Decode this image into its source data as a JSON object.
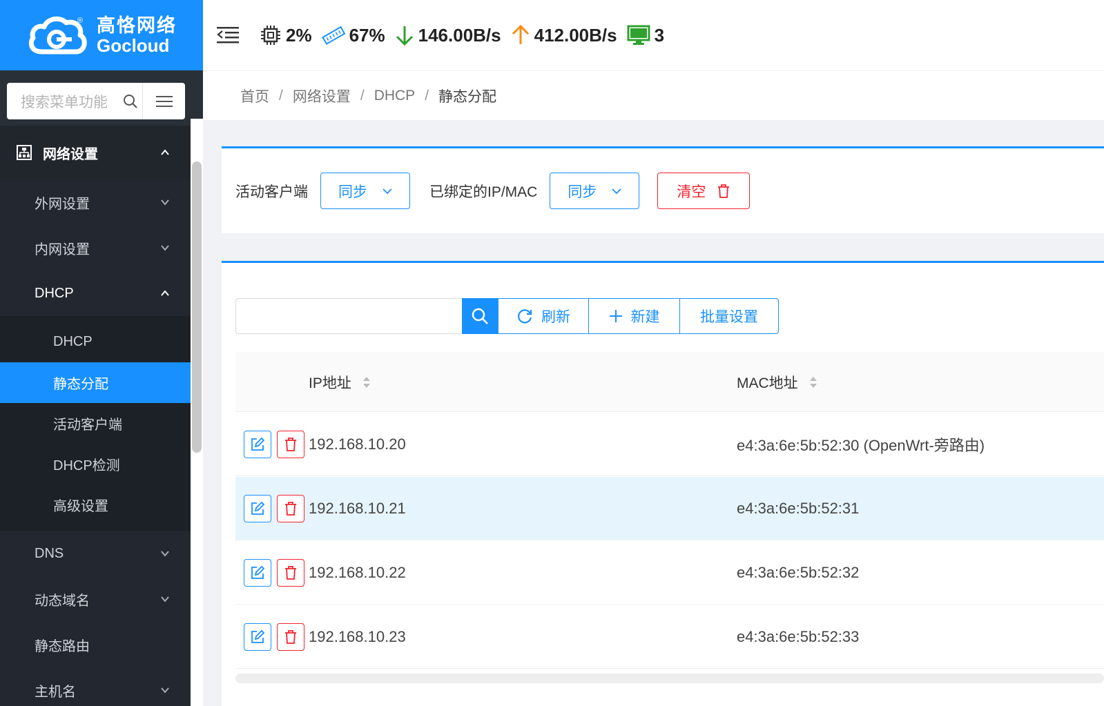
{
  "brand": {
    "name_cn": "高恪网络",
    "name_en": "Gocloud",
    "reg": "®"
  },
  "sidebar": {
    "search_placeholder": "搜索菜单功能",
    "group": {
      "label": "网络设置"
    },
    "items": [
      {
        "label": "外网设置"
      },
      {
        "label": "内网设置"
      },
      {
        "label": "DHCP"
      }
    ],
    "dhcp_children": [
      {
        "label": "DHCP"
      },
      {
        "label": "静态分配"
      },
      {
        "label": "活动客户端"
      },
      {
        "label": "DHCP检测"
      },
      {
        "label": "高级设置"
      }
    ],
    "items_after": [
      {
        "label": "DNS"
      },
      {
        "label": "动态域名"
      },
      {
        "label": "静态路由"
      },
      {
        "label": "主机名"
      }
    ]
  },
  "topbar": {
    "cpu": "2%",
    "mem": "67%",
    "down": "146.00B/s",
    "up": "412.00B/s",
    "clients": "3"
  },
  "breadcrumb": [
    "首页",
    "网络设置",
    "DHCP",
    "静态分配"
  ],
  "sync_card": {
    "active_label": "活动客户端",
    "active_btn": "同步",
    "bound_label": "已绑定的IP/MAC",
    "bound_btn": "同步",
    "clear_btn": "清空"
  },
  "toolbar": {
    "refresh": "刷新",
    "new": "新建",
    "batch": "批量设置"
  },
  "table": {
    "headers": {
      "ip": "IP地址",
      "mac": "MAC地址"
    },
    "rows": [
      {
        "ip": "192.168.10.20",
        "mac": "e4:3a:6e:5b:52:30 (OpenWrt-旁路由)"
      },
      {
        "ip": "192.168.10.21",
        "mac": "e4:3a:6e:5b:52:31"
      },
      {
        "ip": "192.168.10.22",
        "mac": "e4:3a:6e:5b:52:32"
      },
      {
        "ip": "192.168.10.23",
        "mac": "e4:3a:6e:5b:52:33"
      }
    ]
  },
  "colors": {
    "primary": "#1890ff",
    "danger": "#f5222d",
    "sidebar": "#293038",
    "down": "#2ea12e",
    "up": "#fa8c16"
  }
}
